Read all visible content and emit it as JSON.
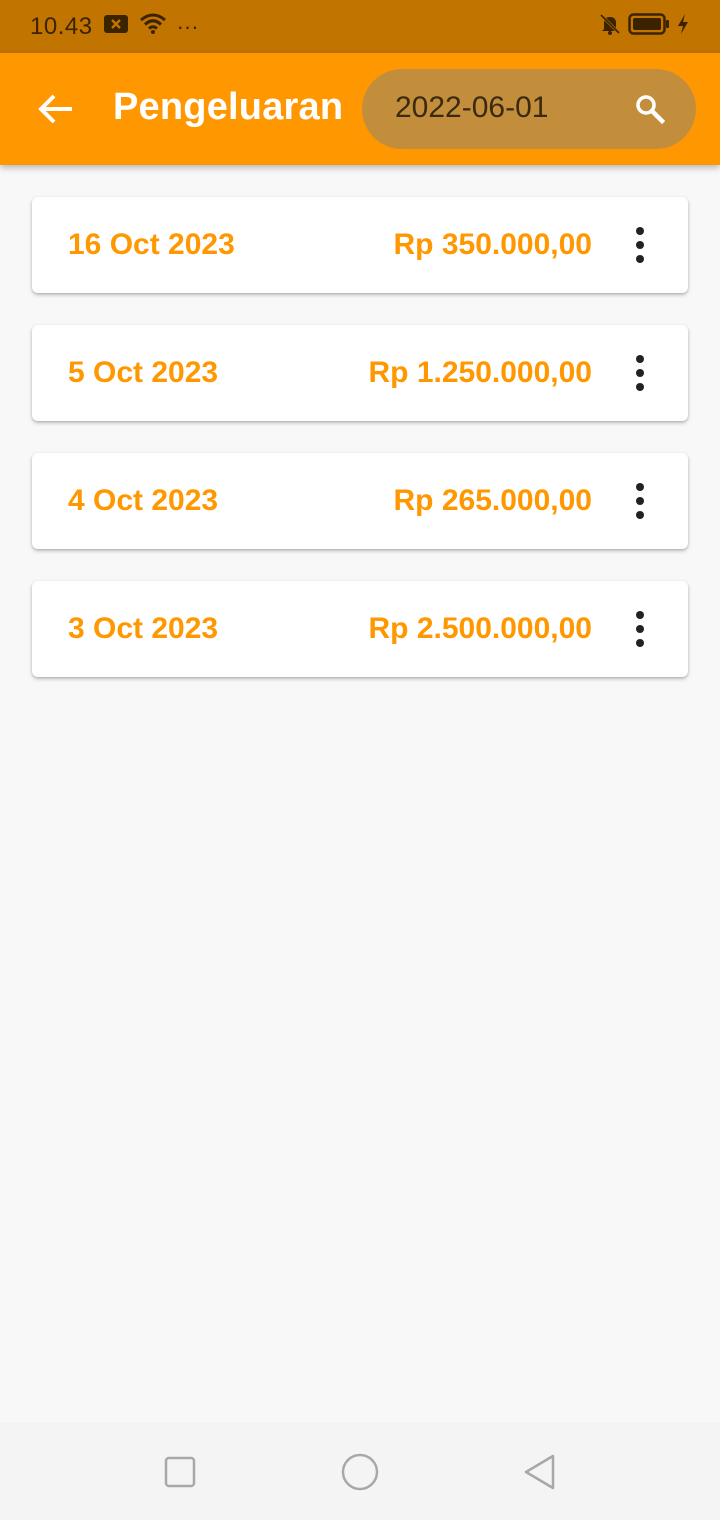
{
  "status_bar": {
    "time": "10.43",
    "dots": "···",
    "icons": [
      "notification-x-icon",
      "wifi-icon",
      "bell-off-icon",
      "battery-icon",
      "charging-bolt-icon"
    ]
  },
  "app_bar": {
    "title": "Pengeluaran",
    "back_icon": "arrow-left-icon",
    "search": {
      "value": "2022-06-01",
      "icon": "search-icon"
    }
  },
  "expenses": [
    {
      "date": "16 Oct 2023",
      "amount": "Rp 350.000,00"
    },
    {
      "date": "5 Oct 2023",
      "amount": "Rp 1.250.000,00"
    },
    {
      "date": "4 Oct 2023",
      "amount": "Rp 265.000,00"
    },
    {
      "date": "3 Oct 2023",
      "amount": "Rp 2.500.000,00"
    }
  ],
  "nav_bar": {
    "buttons": [
      "recents-square-icon",
      "home-circle-icon",
      "back-triangle-icon"
    ]
  },
  "colors": {
    "primary": "#ff9800",
    "status_bar": "#c17400",
    "search_pill": "#c38e3c",
    "background": "#f8f8f8"
  }
}
